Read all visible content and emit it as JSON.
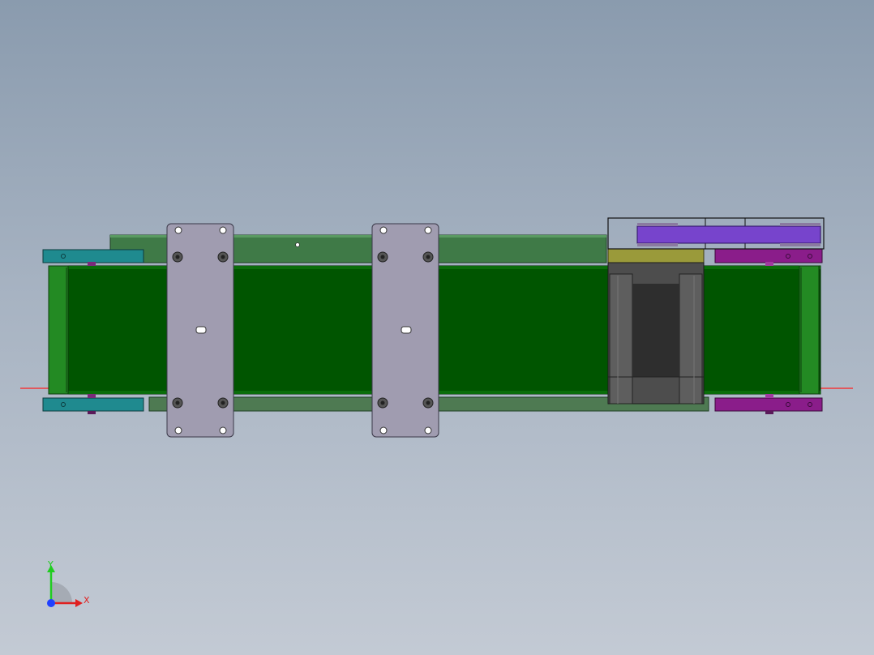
{
  "viewport": {
    "background_top": "#8a9bae",
    "background_bottom": "#c3cad4"
  },
  "model": {
    "colors": {
      "frame": "#3f7a47",
      "belt": "#005500",
      "belt_edge": "#2e8a2e",
      "plate": "#a09cb0",
      "teal_bracket": "#1f8a8f",
      "purple_bracket": "#8a1d8a",
      "motor_body": "#4d4d4d",
      "motor_flange": "#9a9a3a",
      "timing_belt": "#7744cc",
      "axis_x": "#ff2020",
      "axis_y": "#20ff20",
      "axis_z": "#2040ff"
    }
  },
  "triad": {
    "x_label": "X",
    "y_label": "Y",
    "x_icon": "x-axis-arrow-icon",
    "y_icon": "y-axis-arrow-icon",
    "z_icon": "z-axis-dot-icon"
  }
}
